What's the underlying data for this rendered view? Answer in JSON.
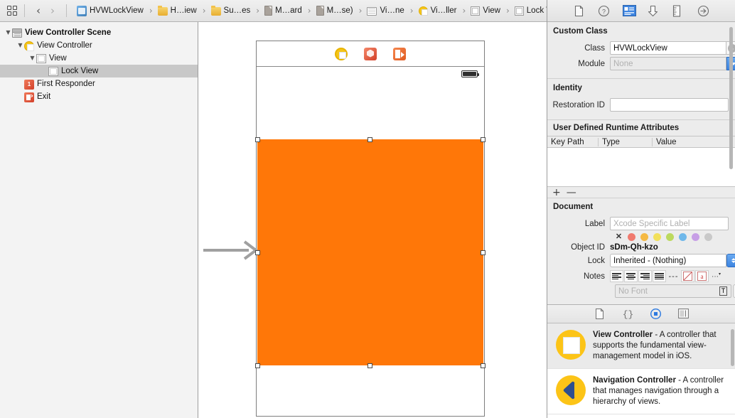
{
  "jump_bar": {
    "breadcrumbs": [
      {
        "label": "HVWLockView",
        "icon": "project-icon"
      },
      {
        "label": "H…iew",
        "icon": "folder-icon"
      },
      {
        "label": "Su…es",
        "icon": "folder-icon"
      },
      {
        "label": "M…ard",
        "icon": "document-icon"
      },
      {
        "label": "M…se)",
        "icon": "document-icon"
      },
      {
        "label": "Vi…ne",
        "icon": "storyboard-scene-icon"
      },
      {
        "label": "Vi…ller",
        "icon": "view-controller-icon"
      },
      {
        "label": "View",
        "icon": "view-icon"
      },
      {
        "label": "Lock View",
        "icon": "view-icon"
      }
    ],
    "back_label": "‹",
    "forward_label": "›",
    "separator": "›"
  },
  "outline": {
    "items": [
      {
        "label": "View Controller Scene",
        "icon": "scene-icon",
        "depth": 0,
        "disclosure": "▼",
        "selected": false,
        "bold": true
      },
      {
        "label": "View Controller",
        "icon": "view-controller-icon",
        "depth": 1,
        "disclosure": "▼",
        "selected": false,
        "bold": false
      },
      {
        "label": "View",
        "icon": "view-icon",
        "depth": 2,
        "disclosure": "▼",
        "selected": false,
        "bold": false
      },
      {
        "label": "Lock View",
        "icon": "view-icon",
        "depth": 3,
        "disclosure": "",
        "selected": true,
        "bold": false
      },
      {
        "label": "First Responder",
        "icon": "first-responder-icon",
        "depth": 1,
        "disclosure": "",
        "selected": false,
        "bold": false
      },
      {
        "label": "Exit",
        "icon": "exit-icon",
        "depth": 1,
        "disclosure": "",
        "selected": false,
        "bold": false
      }
    ]
  },
  "canvas": {
    "scene_dock_icons": [
      "view-controller-icon",
      "first-responder-icon",
      "exit-icon"
    ],
    "selected_view_color": "#ff7708",
    "selected_view_name": "Lock View",
    "entry_point_arrow": "storyboard-entry-point-arrow"
  },
  "inspector": {
    "toolbar_icons": [
      {
        "name": "file-inspector-icon",
        "selected": false
      },
      {
        "name": "quick-help-icon",
        "selected": false
      },
      {
        "name": "identity-inspector-icon",
        "selected": true
      },
      {
        "name": "attributes-inspector-icon",
        "selected": false
      },
      {
        "name": "size-inspector-icon",
        "selected": false
      },
      {
        "name": "connections-inspector-icon",
        "selected": false
      }
    ],
    "custom_class": {
      "title": "Custom Class",
      "class_label": "Class",
      "class_value": "HVWLockView",
      "module_label": "Module",
      "module_value": "",
      "module_placeholder": "None"
    },
    "identity": {
      "title": "Identity",
      "restoration_id_label": "Restoration ID",
      "restoration_id_value": "",
      "restoration_id_placeholder": ""
    },
    "runtime_attributes": {
      "title": "User Defined Runtime Attributes",
      "columns": [
        "Key Path",
        "Type",
        "Value"
      ],
      "rows": [],
      "add_label": "+",
      "remove_label": "—"
    },
    "document": {
      "title": "Document",
      "label_label": "Label",
      "label_value": "",
      "label_placeholder": "Xcode Specific Label",
      "swatches": [
        "clear",
        "#f07a6e",
        "#f5b942",
        "#f2e05a",
        "#bcd95e",
        "#6fb8ea",
        "#c79fe6",
        "#c9c9c9"
      ],
      "swatch_clear_glyph": "✕",
      "object_id_label": "Object ID",
      "object_id_value": "sDm-Qh-kzo",
      "lock_label": "Lock",
      "lock_value": "Inherited - (Nothing)",
      "notes_label": "Notes",
      "notes_tools": [
        "align-left-icon",
        "align-center-icon",
        "align-right-icon",
        "align-justify-icon",
        "list-icon",
        "no-color-icon",
        "text-color-icon",
        "more-options-icon"
      ],
      "font_value": "",
      "font_placeholder": "No Font",
      "font_button": "T"
    }
  },
  "library": {
    "toolbar_icons": [
      {
        "name": "file-template-library-icon",
        "selected": false
      },
      {
        "name": "code-snippet-library-icon",
        "selected": false
      },
      {
        "name": "object-library-icon",
        "selected": true
      },
      {
        "name": "media-library-icon",
        "selected": false
      }
    ],
    "items": [
      {
        "title": "View Controller",
        "description": " - A controller that supports the fundamental view-management model in iOS.",
        "icon": "view-controller-library-icon",
        "selected": true
      },
      {
        "title": "Navigation Controller",
        "description": " - A controller that manages navigation through a hierarchy of views.",
        "icon": "navigation-controller-library-icon",
        "selected": false
      }
    ]
  }
}
